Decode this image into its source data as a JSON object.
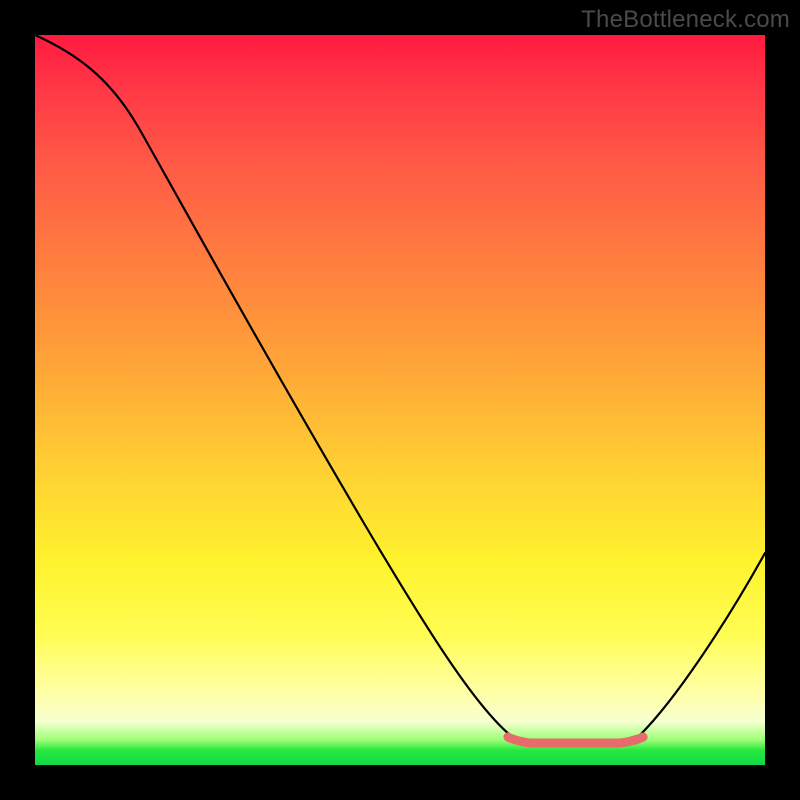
{
  "watermark": "TheBottleneck.com",
  "chart_data": {
    "type": "line",
    "title": "",
    "xlabel": "",
    "ylabel": "",
    "xlim": [
      0,
      100
    ],
    "ylim": [
      0,
      100
    ],
    "grid": false,
    "series": [
      {
        "name": "bottleneck-curve",
        "x": [
          0,
          6,
          12,
          18,
          24,
          30,
          36,
          42,
          48,
          54,
          60,
          64,
          68,
          72,
          76,
          80,
          84,
          88,
          92,
          96,
          100
        ],
        "values": [
          100,
          97,
          93,
          84,
          74,
          64,
          54,
          44,
          34,
          24,
          14,
          8,
          4,
          2.5,
          2.5,
          2.5,
          4,
          8,
          15,
          24,
          33
        ]
      },
      {
        "name": "flat-highlight",
        "x": [
          64,
          68,
          72,
          76,
          80,
          84
        ],
        "values": [
          4.2,
          4.2,
          4.2,
          4.2,
          4.2,
          4.2
        ]
      }
    ],
    "colors": {
      "curve": "#000000",
      "highlight": "#e86b6b",
      "gradient_top": "#ff1a40",
      "gradient_mid": "#fff22e",
      "gradient_bottom": "#0fd948"
    },
    "legend": {
      "visible": false
    }
  }
}
